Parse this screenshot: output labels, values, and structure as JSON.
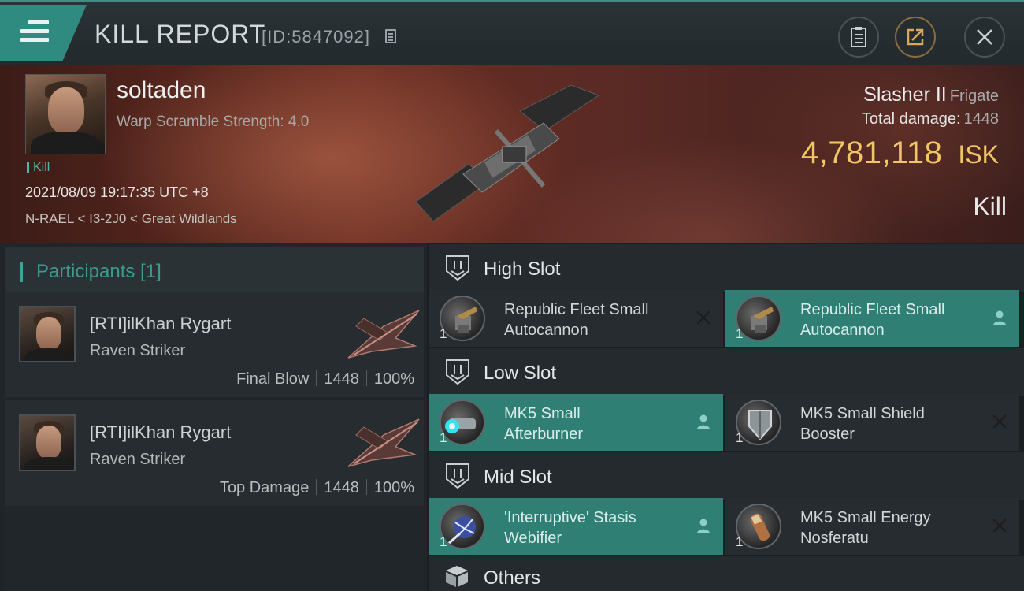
{
  "header": {
    "title": "KILL REPORT",
    "report_id": "[ID:5847092]"
  },
  "victim": {
    "name": "soltaden",
    "warp_scramble": "Warp Scramble Strength: 4.0",
    "tag": "Kill",
    "datetime": "2021/08/09 19:17:35 UTC +8",
    "location": "N-RAEL < I3-2J0 < Great Wildlands",
    "ship_name": "Slasher II",
    "ship_class": "Frigate",
    "damage_label": "Total damage:",
    "damage_value": "1448",
    "isk_value": "4,781,118",
    "isk_unit": "ISK",
    "result": "Kill"
  },
  "participants": {
    "title": "Participants [1]",
    "items": [
      {
        "name": "[RTI]ilKhan Rygart",
        "ship": "Raven Striker",
        "role": "Final Blow",
        "damage": "1448",
        "percent": "100%"
      },
      {
        "name": "[RTI]ilKhan Rygart",
        "ship": "Raven Striker",
        "role": "Top Damage",
        "damage": "1448",
        "percent": "100%"
      }
    ]
  },
  "slots": {
    "high": {
      "title": "High Slot",
      "modules": [
        {
          "name1": "Republic Fleet Small",
          "name2": "Autocannon",
          "qty": "1",
          "state": "destroyed"
        },
        {
          "name1": "Republic Fleet Small",
          "name2": "Autocannon",
          "qty": "1",
          "state": "dropped"
        }
      ]
    },
    "low": {
      "title": "Low Slot",
      "modules": [
        {
          "name1": "MK5 Small",
          "name2": "Afterburner",
          "qty": "1",
          "state": "dropped"
        },
        {
          "name1": "MK5 Small Shield",
          "name2": "Booster",
          "qty": "1",
          "state": "destroyed"
        }
      ]
    },
    "mid": {
      "title": "Mid Slot",
      "modules": [
        {
          "name1": "'Interruptive' Stasis",
          "name2": "Webifier",
          "qty": "1",
          "state": "dropped"
        },
        {
          "name1": "MK5 Small Energy",
          "name2": "Nosferatu",
          "qty": "1",
          "state": "destroyed"
        }
      ]
    },
    "others": {
      "title": "Others"
    }
  },
  "colors": {
    "accent": "#2f8a80",
    "dropped_bg": "#2f7f75",
    "isk": "#f1c766",
    "participants_title": "#3e9a8e"
  },
  "icons": {
    "menu": "hamburger-icon",
    "copy": "copy-icon",
    "doc": "document-icon",
    "share": "share-icon",
    "close": "close-icon",
    "slot": "slot-shield-icon",
    "others": "cube-icon",
    "destroyed": "x-mark-icon",
    "dropped": "person-icon"
  }
}
